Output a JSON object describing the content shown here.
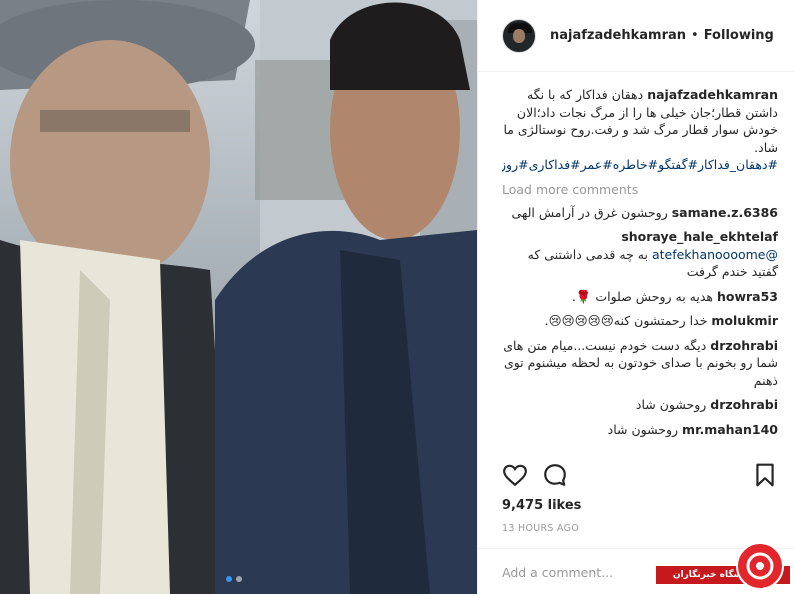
{
  "post": {
    "username": "najafzadehkamran",
    "separator": "•",
    "follow_status": "Following",
    "caption_text": "دهقان فداکار که با نگه داشتن قطار؛جان خیلی ها را از مرگ نجات داد؛الان خودش سوار قطار مرگ شد و رفت.روح نوستالژی ما شاد.",
    "caption_tags": "#دهقان_فداکار#گفتگو#خاطره#عمر#فداکاری#روزگار#برگ_ریزان#پاییز",
    "load_more": "Load more comments",
    "likes": "9,475 likes",
    "time": "13 HOURS AGO",
    "add_comment_placeholder": "Add a comment...",
    "carousel": {
      "total": 2,
      "active": 1
    }
  },
  "comments": [
    {
      "user": "samane.z.6386",
      "text": "روحشون غرق در آرامش الهی"
    },
    {
      "user": "shoraye_hale_ekhtelaf",
      "mention": "@atefekhanoooome",
      "text": "به چه قدمی داشتنی که گفتید خندم گرفت"
    },
    {
      "user": "howra53",
      "text": "هدیه به روحش صلوات 🌹."
    },
    {
      "user": "molukmir",
      "text": "خدا رحمتشون کنه😢😢😢😢😢."
    },
    {
      "user": "drzohrabi",
      "text": "دیگه دست خودم نیست...میام متن های شما رو بخونم با صدای خودتون به لحظه میشنوم توی ذهنم"
    },
    {
      "user": "drzohrabi",
      "text": "روحشون شاد"
    },
    {
      "user": "mr.mahan140",
      "text": "روحشون شاد"
    }
  ],
  "watermark": {
    "text": "باشگاه خبرنگاران",
    "color": "#c5191e"
  },
  "icons": [
    "heart-icon",
    "comment-icon",
    "bookmark-icon"
  ]
}
